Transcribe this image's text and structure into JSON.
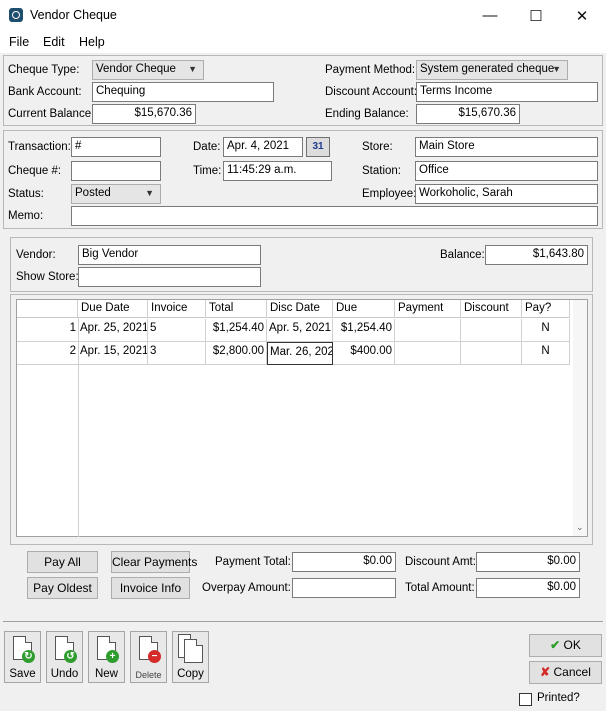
{
  "window": {
    "title": "Vendor Cheque",
    "min": "—",
    "max": "☐",
    "close": "✕"
  },
  "menu": [
    "File",
    "Edit",
    "Help"
  ],
  "header": {
    "cheque_type_label": "Cheque Type:",
    "cheque_type_value": "Vendor Cheque",
    "bank_account_label": "Bank Account:",
    "bank_account_value": "Chequing",
    "current_balance_label": "Current Balance:",
    "current_balance_value": "$15,670.36",
    "payment_method_label": "Payment Method:",
    "payment_method_value": "System generated cheque",
    "discount_account_label": "Discount Account:",
    "discount_account_value": "Terms Income",
    "ending_balance_label": "Ending Balance:",
    "ending_balance_value": "$15,670.36"
  },
  "details": {
    "transaction_label": "Transaction:",
    "transaction_value": "#",
    "cheque_no_label": "Cheque #:",
    "cheque_no_value": "",
    "status_label": "Status:",
    "status_value": "Posted",
    "memo_label": "Memo:",
    "memo_value": "",
    "date_label": "Date:",
    "date_value": "Apr. 4, 2021",
    "calendar_text": "31",
    "time_label": "Time:",
    "time_value": "11:45:29 a.m.",
    "store_label": "Store:",
    "store_value": "Main Store",
    "station_label": "Station:",
    "station_value": "Office",
    "employee_label": "Employee:",
    "employee_value": "Workoholic, Sarah"
  },
  "vendor": {
    "vendor_label": "Vendor:",
    "vendor_value": "Big Vendor",
    "show_store_label": "Show Store:",
    "show_store_value": "",
    "balance_label": "Balance:",
    "balance_value": "$1,643.80"
  },
  "grid": {
    "columns": [
      "Due Date",
      "Invoice",
      "Total",
      "Disc Date",
      "Due",
      "Payment",
      "Discount",
      "Pay?"
    ],
    "rows": [
      {
        "num": "1",
        "due_date": "Apr. 25, 2021",
        "invoice": "5",
        "total": "$1,254.40",
        "disc_date": "Apr. 5, 2021",
        "due": "$1,254.40",
        "payment": "",
        "discount": "",
        "pay": "N"
      },
      {
        "num": "2",
        "due_date": "Apr. 15, 2021",
        "invoice": "3",
        "total": "$2,800.00",
        "disc_date": "Mar. 26, 202",
        "due": "$400.00",
        "payment": "",
        "discount": "",
        "pay": "N"
      }
    ]
  },
  "totals": {
    "pay_all": "Pay All",
    "clear_payments": "Clear Payments",
    "pay_oldest": "Pay Oldest",
    "invoice_info": "Invoice Info",
    "payment_total_label": "Payment Total:",
    "payment_total_value": "$0.00",
    "overpay_label": "Overpay Amount:",
    "overpay_value": "",
    "discount_amt_label": "Discount Amt:",
    "discount_amt_value": "$0.00",
    "total_amount_label": "Total Amount:",
    "total_amount_value": "$0.00"
  },
  "toolbar": {
    "save": "Save",
    "undo": "Undo",
    "new": "New",
    "delete": "Delete",
    "copy": "Copy"
  },
  "actions": {
    "ok": "OK",
    "cancel": "Cancel",
    "printed": "Printed?"
  },
  "colors": {
    "ok_check": "#2e9d2e",
    "cancel_x": "#d42a2a",
    "save_badge": "#2e9d2e",
    "delete_badge": "#d42a2a"
  }
}
